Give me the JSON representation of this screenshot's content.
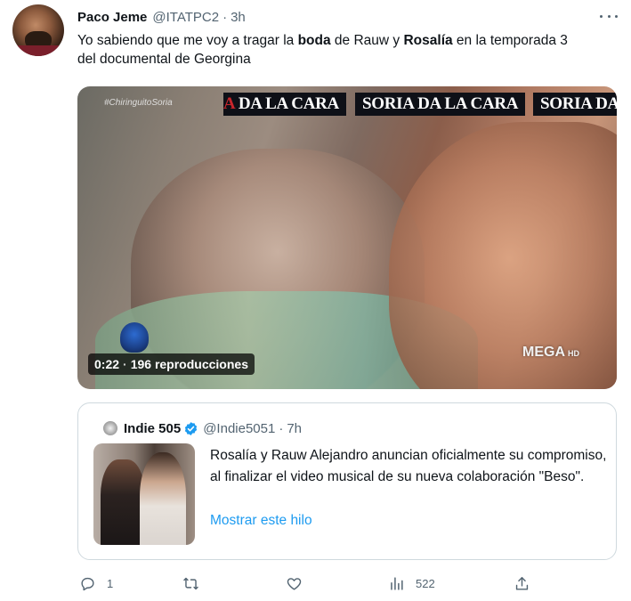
{
  "tweet": {
    "author_name": "Paco Jeme",
    "author_handle": "@ITATPC2",
    "separator": "·",
    "time": "3h",
    "text_parts": [
      "Yo sabiendo que me voy a tragar la ",
      "boda",
      " de Rauw y ",
      "Rosalía",
      " en la temporada 3 del documental de Georgina"
    ]
  },
  "media": {
    "hashtag": "#ChiringuitoSoria",
    "banner_prefix": "A",
    "banner_1": "DA LA CARA",
    "banner_2": "SORIA DA LA CARA",
    "banner_3": "SORIA DA",
    "channel_logo": "MEGA",
    "channel_quality": "HD",
    "duration": "0:22",
    "views_separator": "·",
    "views": "196 reproducciones"
  },
  "quote": {
    "author_name": "Indie 505",
    "author_handle": "@Indie5051",
    "separator": "·",
    "time": "7h",
    "text": "Rosalía y Rauw Alejandro anuncian oficialmente su compromiso, al finalizar el video musical de su nueva colaboración \"Beso\".",
    "show_thread": "Mostrar este hilo"
  },
  "actions": {
    "replies": "1",
    "retweets": "",
    "likes": "",
    "views": "522"
  },
  "colors": {
    "link": "#1d9bf0",
    "secondary_text": "#536471",
    "verified": "#1d9bf0",
    "banner_bg": "#0e1017",
    "banner_accent": "#c8262c"
  },
  "icons": [
    "more-icon",
    "verified-icon",
    "reply-icon",
    "retweet-icon",
    "like-icon",
    "views-icon",
    "share-icon"
  ]
}
